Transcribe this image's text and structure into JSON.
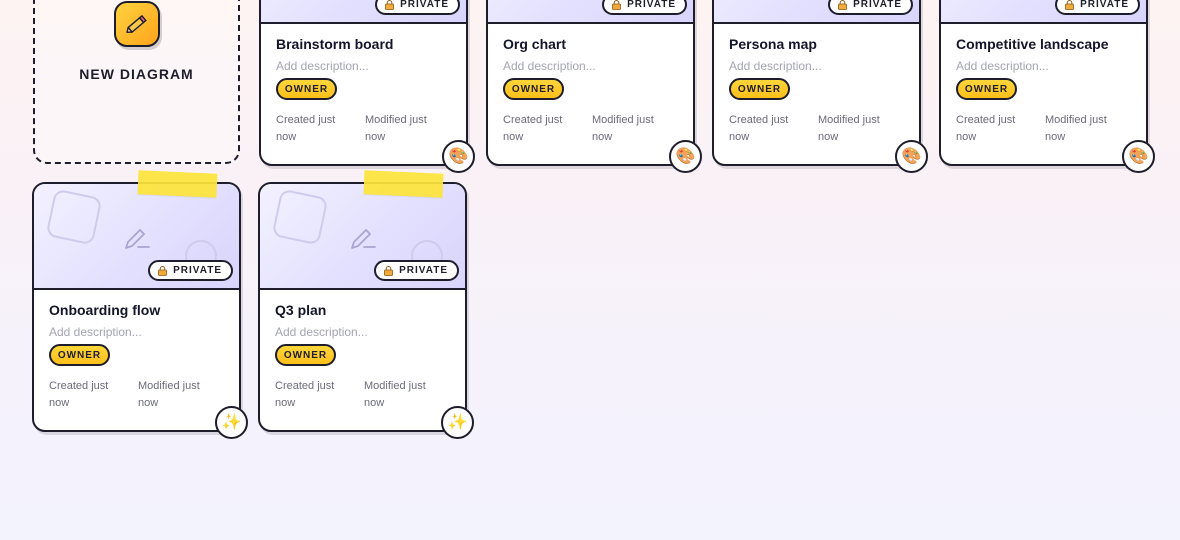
{
  "new_diagram": {
    "label": "NEW DIAGRAM",
    "icon": "pencil-icon"
  },
  "cards": [
    {
      "title": "Brainstorm board",
      "description_placeholder": "Add description...",
      "visibility": "PRIVATE",
      "role": "OWNER",
      "created": "Created just now",
      "modified": "Modified just now",
      "avatar": "🎨",
      "avatar_icon": "palette-icon"
    },
    {
      "title": "Org chart",
      "description_placeholder": "Add description...",
      "visibility": "PRIVATE",
      "role": "OWNER",
      "created": "Created just now",
      "modified": "Modified just now",
      "avatar": "🎨",
      "avatar_icon": "palette-icon"
    },
    {
      "title": "Persona map",
      "description_placeholder": "Add description...",
      "visibility": "PRIVATE",
      "role": "OWNER",
      "created": "Created just now",
      "modified": "Modified just now",
      "avatar": "🎨",
      "avatar_icon": "palette-icon"
    },
    {
      "title": "Competitive landscape",
      "description_placeholder": "Add description...",
      "visibility": "PRIVATE",
      "role": "OWNER",
      "created": "Created just now",
      "modified": "Modified just now",
      "avatar": "🎨",
      "avatar_icon": "palette-icon"
    },
    {
      "title": "Onboarding flow",
      "description_placeholder": "Add description...",
      "visibility": "PRIVATE",
      "role": "OWNER",
      "created": "Created just now",
      "modified": "Modified just now",
      "avatar": "✨",
      "avatar_icon": "sparkles-icon"
    },
    {
      "title": "Q3 plan",
      "description_placeholder": "Add description...",
      "visibility": "PRIVATE",
      "role": "OWNER",
      "created": "Created just now",
      "modified": "Modified just now",
      "avatar": "✨",
      "avatar_icon": "sparkles-icon"
    }
  ],
  "colors": {
    "outline": "#1d1d2b",
    "owner_badge": "#fbbf1a",
    "tape": "#fde53a",
    "thumbnail": "#e3e0ff"
  }
}
